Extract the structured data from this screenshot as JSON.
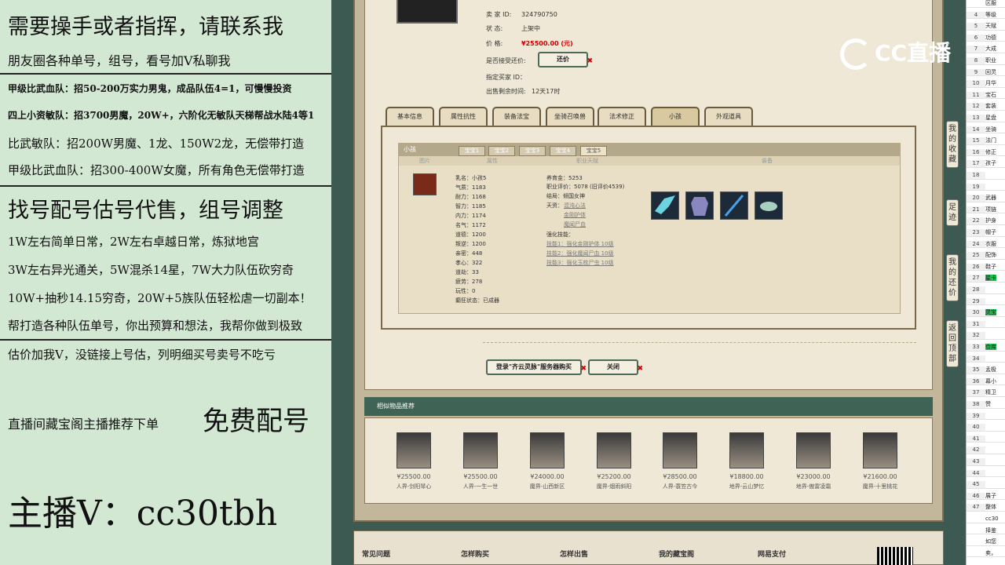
{
  "overlay": {
    "lines": [
      "需要操手或者指挥，请联系我",
      "朋友圈各种单号，组号，看号加V私聊我",
      "甲级比武血队：招50-200万实力男鬼，成品队伍4=1，可慢慢投资",
      "四上小资敏队：招3700男魔，20W+，六阶化无敏队天梯帮战水陆4等1",
      "比武敏队：招200W男魔、1龙、150W2龙，无偿带打造",
      "甲级比武血队：招300-400W女魔，所有角色无偿带打造",
      "找号配号估号代售，组号调整",
      "1W左右简单日常，2W左右卓越日常，炼狱地宫",
      "3W左右异光通关，5W混杀14星，7W大力队伍砍穷奇",
      "10W+抽秒14.15穷奇，20W+5族队伍轻松虐一切副本！",
      "帮打造各种队伍单号，你出预算和想法，我帮你做到极致",
      "估价加我V，没链接上号估，列明细买号卖号不吃亏",
      "直播间藏宝阁主播推荐下单",
      "免费配号",
      "主播V：cc30tbh"
    ]
  },
  "listing": {
    "seller_label": "卖 家 ID:",
    "seller_id": "324790750",
    "status_label": "状 态:",
    "status": "上架中",
    "price_label": "价 格:",
    "price": "¥25500.00 (元)",
    "counter_label": "是否接受还价:",
    "counter_button": "还价",
    "buyer_label": "指定买家 ID：",
    "remaining_label": "出售剩余时间:",
    "remaining": "12天17时"
  },
  "tabs": [
    "基本信息",
    "属性抗性",
    "装备法宝",
    "坐骑召唤兽",
    "法术修正",
    "小孩",
    "外观道具"
  ],
  "child_panel": {
    "title": "小孩",
    "subtabs": [
      "宝宝1",
      "宝宝2",
      "宝宝3",
      "宝宝4",
      "宝宝5"
    ],
    "columns": [
      "图片",
      "属性",
      "职业天赋",
      "装备"
    ],
    "stats": [
      "乳名：小孩5",
      "气质：1183",
      "耐力：1168",
      "智力：1185",
      "内力：1174",
      "名气：1172",
      "道德：1200",
      "叛逆：1200",
      "亲密：448",
      "孝心：322",
      "道劫：33",
      "疲劳：278",
      "玩性：0",
      "癫狂状态：已成器"
    ],
    "career": [
      "养育金：5253",
      "职业评价：5078 (旧评价4539)",
      "结局：倾国女神",
      "天资：",
      "混沌心法",
      "金刚护体",
      "魔闻尸血",
      "强化技能：",
      "技能1：强化金刚护体 10级",
      "技能2：强化魔闻尸血 10级",
      "技能3：强化玉枕尸虫 10级"
    ]
  },
  "actions": {
    "server_buy": "登录\"齐云灵脉\"服务器购买",
    "close": "关闭"
  },
  "similar": {
    "title": "相似物品推荐",
    "items": [
      {
        "price": "¥25500.00",
        "server": "人界-剑阳琴心"
      },
      {
        "price": "¥25500.00",
        "server": "人界-一生一世"
      },
      {
        "price": "¥24000.00",
        "server": "魔界-山西新区"
      },
      {
        "price": "¥25200.00",
        "server": "魔界-烟雨斜阳"
      },
      {
        "price": "¥28500.00",
        "server": "人界-蓑笠古今"
      },
      {
        "price": "¥18800.00",
        "server": "地界-云山梦忆"
      },
      {
        "price": "¥23000.00",
        "server": "地界-傲雷凌霜"
      },
      {
        "price": "¥21600.00",
        "server": "魔界-十里桃花"
      }
    ]
  },
  "footer": [
    "常见问题",
    "怎样购买",
    "怎样出售",
    "我的藏宝阁",
    "网易支付"
  ],
  "sidebar": [
    "我的收藏",
    "足迹",
    "我的还价",
    "返回顶部"
  ],
  "logo_text": "CC直播",
  "sheet": {
    "rows": [
      {
        "n": "",
        "c": "区服"
      },
      {
        "n": "4",
        "c": "等级"
      },
      {
        "n": "5",
        "c": "天赋"
      },
      {
        "n": "6",
        "c": "功德"
      },
      {
        "n": "7",
        "c": "大成"
      },
      {
        "n": "8",
        "c": "职业"
      },
      {
        "n": "9",
        "c": "回灵"
      },
      {
        "n": "10",
        "c": "月华"
      },
      {
        "n": "11",
        "c": "宝石"
      },
      {
        "n": "12",
        "c": "套装"
      },
      {
        "n": "13",
        "c": "星盘"
      },
      {
        "n": "14",
        "c": "坐骑"
      },
      {
        "n": "15",
        "c": "法门"
      },
      {
        "n": "16",
        "c": "修正"
      },
      {
        "n": "17",
        "c": "孩子"
      },
      {
        "n": "18",
        "c": ""
      },
      {
        "n": "19",
        "c": ""
      },
      {
        "n": "20",
        "c": "武器"
      },
      {
        "n": "21",
        "c": "项链"
      },
      {
        "n": "22",
        "c": "护身"
      },
      {
        "n": "23",
        "c": "帽子"
      },
      {
        "n": "24",
        "c": "衣服"
      },
      {
        "n": "25",
        "c": "配饰"
      },
      {
        "n": "26",
        "c": "鞋子"
      },
      {
        "n": "27",
        "c": "星卡",
        "g": true
      },
      {
        "n": "28",
        "c": ""
      },
      {
        "n": "29",
        "c": ""
      },
      {
        "n": "30",
        "c": "灵宝",
        "g": true
      },
      {
        "n": "31",
        "c": ""
      },
      {
        "n": "32",
        "c": ""
      },
      {
        "n": "33",
        "c": "仓库",
        "g": true
      },
      {
        "n": "34",
        "c": ""
      },
      {
        "n": "35",
        "c": "孟极"
      },
      {
        "n": "36",
        "c": "幕小"
      },
      {
        "n": "37",
        "c": "精卫"
      },
      {
        "n": "38",
        "c": "赞"
      },
      {
        "n": "39",
        "c": ""
      },
      {
        "n": "40",
        "c": ""
      },
      {
        "n": "41",
        "c": ""
      },
      {
        "n": "42",
        "c": ""
      },
      {
        "n": "43",
        "c": ""
      },
      {
        "n": "44",
        "c": ""
      },
      {
        "n": "45",
        "c": ""
      },
      {
        "n": "46",
        "c": "展子"
      },
      {
        "n": "47",
        "c": "整体"
      },
      {
        "n": "",
        "c": "cc30"
      },
      {
        "n": "",
        "c": "择鉴"
      },
      {
        "n": "",
        "c": "如您"
      },
      {
        "n": "",
        "c": "卖，"
      }
    ]
  }
}
